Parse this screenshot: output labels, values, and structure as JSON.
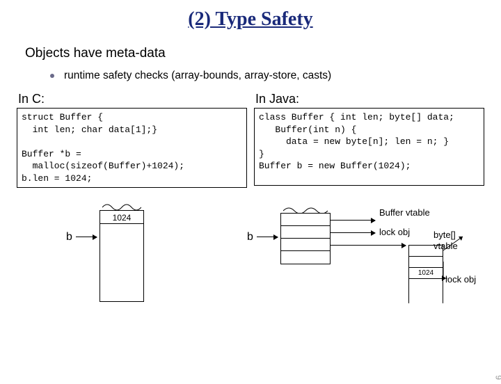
{
  "title": "(2) Type Safety",
  "heading": "Objects have meta-data",
  "bullet": "runtime safety checks (array-bounds, array-store, casts)",
  "left": {
    "label": "In C:",
    "code": "struct Buffer {\n  int len; char data[1];}\n\nBuffer *b =\n  malloc(sizeof(Buffer)+1024);\nb.len = 1024;"
  },
  "right": {
    "label": "In Java:",
    "code": "class Buffer { int len; byte[] data;\n   Buffer(int n) {\n     data = new byte[n]; len = n; }\n}\nBuffer b = new Buffer(1024);"
  },
  "diagram": {
    "b_left": "b",
    "b_right": "b",
    "size_label_left": "1024",
    "size_label_right": "1024",
    "buffer_vtable": "Buffer vtable",
    "lock_obj": "lock obj",
    "byte_vtable": "byte[]\nvtable"
  },
  "page_number": "9"
}
